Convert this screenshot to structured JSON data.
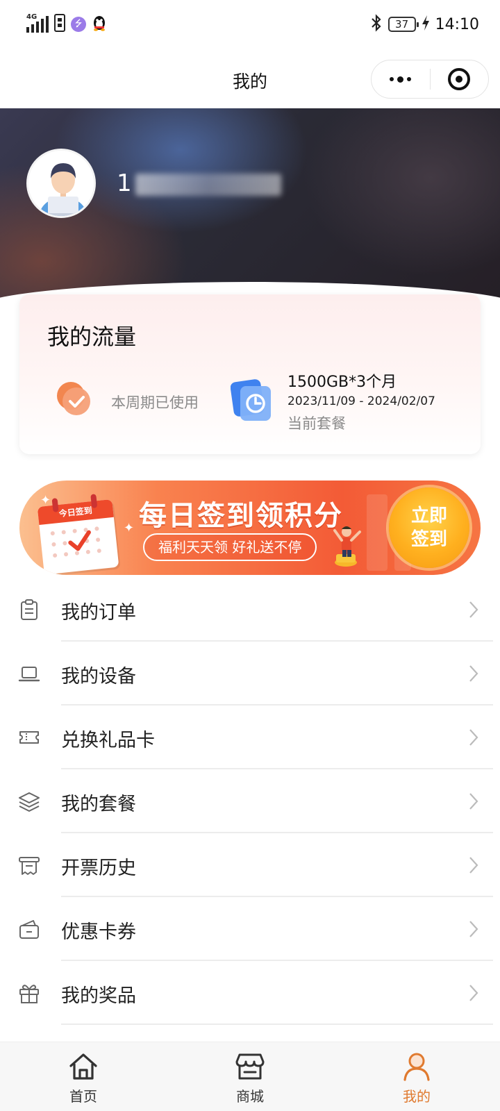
{
  "status_bar": {
    "network": "4G",
    "battery": "37",
    "time": "14:10"
  },
  "nav": {
    "title": "我的"
  },
  "profile": {
    "phone_visible_prefix": "1"
  },
  "traffic": {
    "title": "我的流量",
    "used_label": "本周期已使用",
    "plan_name": "1500GB*3个月",
    "plan_dates": "2023/11/09 - 2024/02/07",
    "plan_label": "当前套餐"
  },
  "banner": {
    "calendar_label": "今日签到",
    "title": "每日签到领积分",
    "subtitle": "福利天天领  好礼送不停",
    "button_line1": "立即",
    "button_line2": "签到"
  },
  "menu": {
    "items": [
      {
        "label": "我的订单",
        "icon": "order-icon"
      },
      {
        "label": "我的设备",
        "icon": "device-icon"
      },
      {
        "label": "兑换礼品卡",
        "icon": "gift-card-icon"
      },
      {
        "label": "我的套餐",
        "icon": "package-layers-icon"
      },
      {
        "label": "开票历史",
        "icon": "invoice-icon"
      },
      {
        "label": "优惠卡券",
        "icon": "coupon-wallet-icon"
      },
      {
        "label": "我的奖品",
        "icon": "prize-gift-icon"
      }
    ]
  },
  "tabs": [
    {
      "label": "首页",
      "icon": "home-icon"
    },
    {
      "label": "商城",
      "icon": "store-icon"
    },
    {
      "label": "我的",
      "icon": "profile-icon",
      "active": true
    }
  ],
  "colors": {
    "accent": "#e07a2f",
    "banner_orange": "#f35b36",
    "button_yellow": "#ffb01f"
  }
}
